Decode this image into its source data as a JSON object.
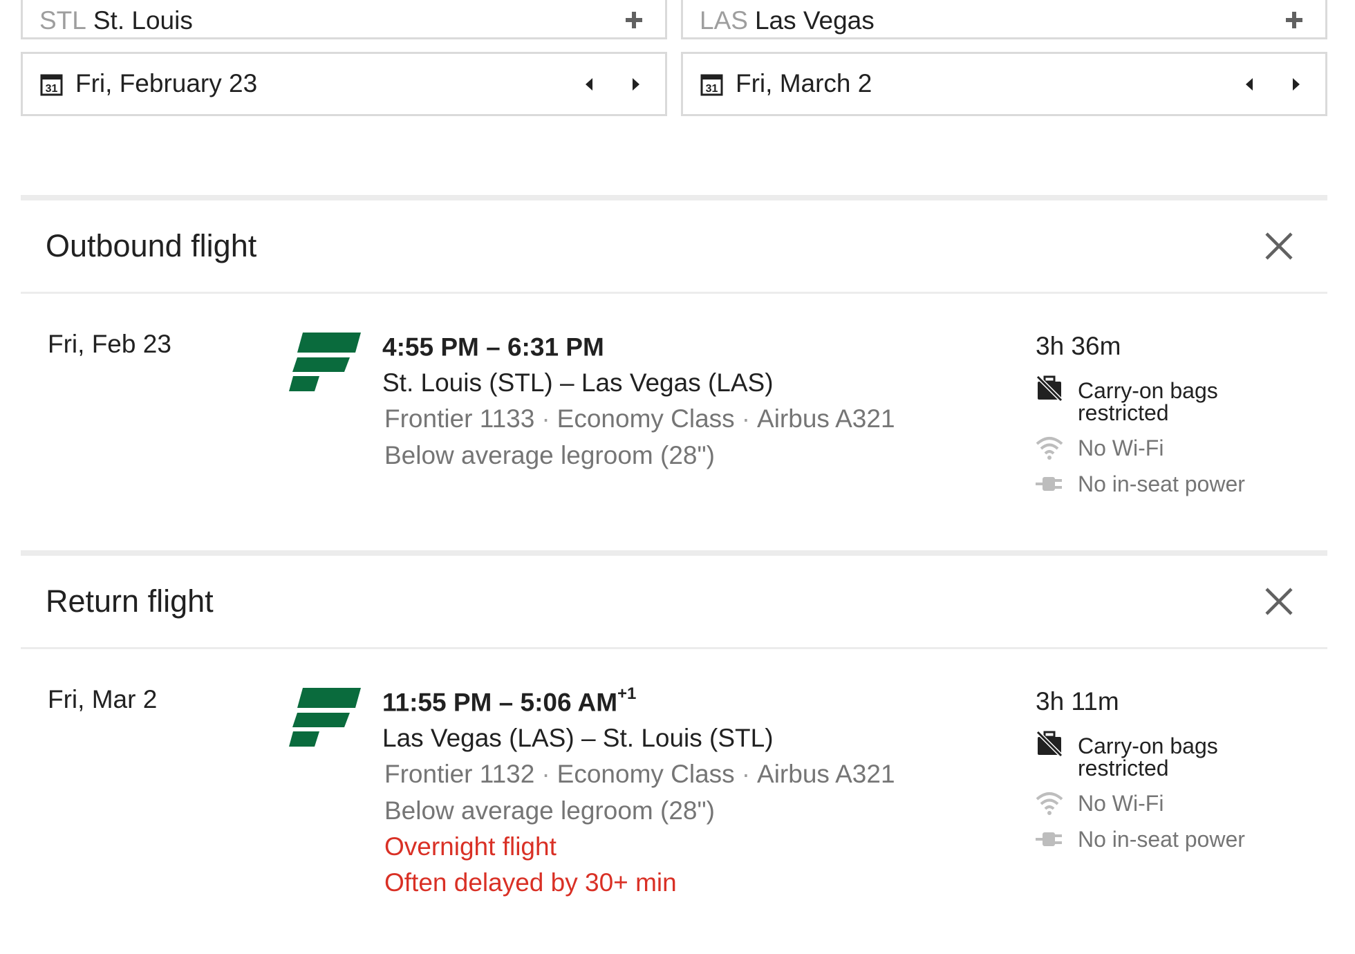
{
  "search": {
    "origin": {
      "code": "STL",
      "name": "St. Louis"
    },
    "destination": {
      "code": "LAS",
      "name": "Las Vegas"
    },
    "depart_date": "Fri, February 23",
    "return_date": "Fri, March 2"
  },
  "icons": {
    "plus": "plus-icon",
    "calendar": "calendar-icon",
    "calendar_day": "31",
    "prev": "chevron-left-icon",
    "next": "chevron-right-icon",
    "close": "close-icon",
    "bag": "no-bag-icon",
    "wifi": "wifi-icon",
    "power": "power-plug-icon"
  },
  "colors": {
    "frontier_green": "#0a6b3d",
    "warning_red": "#d93025",
    "secondary_text": "#757575",
    "divider": "#ececec"
  },
  "outbound": {
    "title": "Outbound flight",
    "date": "Fri, Feb 23",
    "times": "4:55 PM – 6:31 PM",
    "day_offset": "",
    "route": "St. Louis (STL) – Las Vegas (LAS)",
    "flight": "Frontier 1133",
    "cabin": "Economy Class",
    "aircraft": "Airbus A321",
    "legroom": "Below average legroom (28\")",
    "warnings": [],
    "duration": "3h 36m",
    "amenities": {
      "bags_line1": "Carry-on bags",
      "bags_line2": "restricted",
      "wifi": "No Wi-Fi",
      "power": "No in-seat power"
    }
  },
  "return": {
    "title": "Return flight",
    "date": "Fri, Mar 2",
    "times": "11:55 PM – 5:06 AM",
    "day_offset": "+1",
    "route": "Las Vegas (LAS) – St. Louis (STL)",
    "flight": "Frontier 1132",
    "cabin": "Economy Class",
    "aircraft": "Airbus A321",
    "legroom": "Below average legroom (28\")",
    "warnings": [
      "Overnight flight",
      "Often delayed by 30+ min"
    ],
    "duration": "3h 11m",
    "amenities": {
      "bags_line1": "Carry-on bags",
      "bags_line2": "restricted",
      "wifi": "No Wi-Fi",
      "power": "No in-seat power"
    }
  }
}
